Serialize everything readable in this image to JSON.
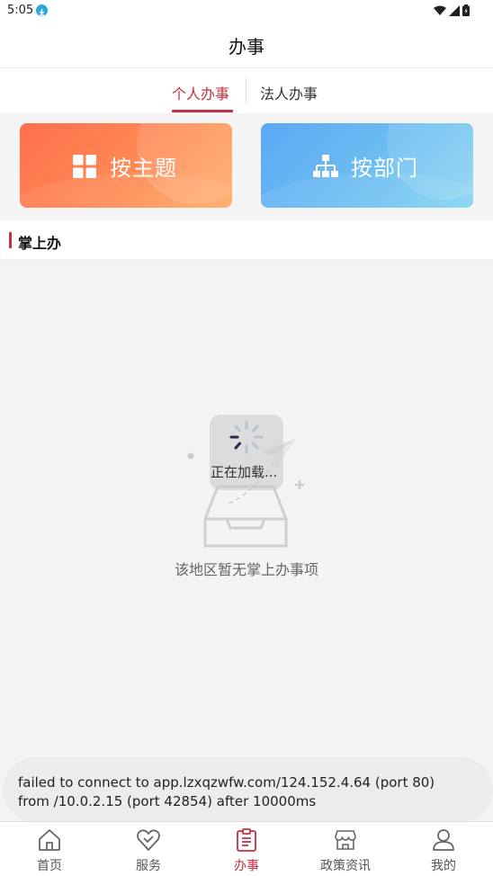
{
  "status": {
    "time": "5:05"
  },
  "header": {
    "title": "办事"
  },
  "tabs": [
    {
      "label": "个人办事",
      "active": true
    },
    {
      "label": "法人办事",
      "active": false
    }
  ],
  "cards": [
    {
      "label": "按主题",
      "icon": "grid-icon",
      "color": "#ff7a4f"
    },
    {
      "label": "按部门",
      "icon": "org-chart-icon",
      "color": "#64b4f3"
    }
  ],
  "section": {
    "title": "掌上办"
  },
  "loading": {
    "text": "正在加载..."
  },
  "empty": {
    "text": "该地区暂无掌上办事项"
  },
  "toast": {
    "message": "failed to connect to app.lzxqzwfw.com/124.152.4.64 (port 80) from /10.0.2.15 (port 42854) after 10000ms"
  },
  "tabbar": [
    {
      "label": "首页",
      "icon": "home-icon",
      "active": false
    },
    {
      "label": "服务",
      "icon": "heart-icon",
      "active": false
    },
    {
      "label": "办事",
      "icon": "clipboard-icon",
      "active": true
    },
    {
      "label": "政策资讯",
      "icon": "store-icon",
      "active": false
    },
    {
      "label": "我的",
      "icon": "user-icon",
      "active": false
    }
  ],
  "colors": {
    "accent": "#c62f3f",
    "theme_card": "#ff7a4f",
    "dept_card": "#64b4f3",
    "background": "#f4f4f4"
  }
}
